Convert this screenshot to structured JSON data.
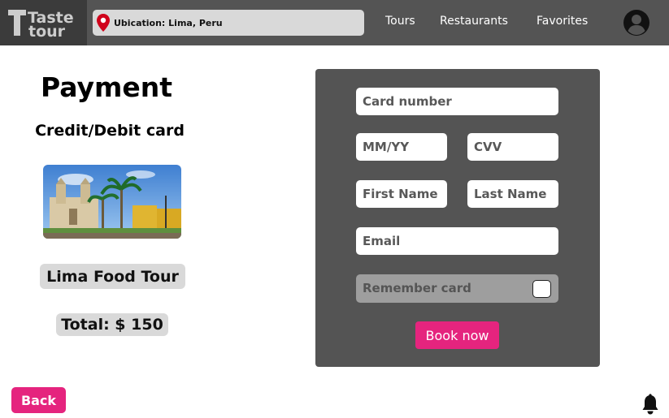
{
  "header": {
    "logo": {
      "line1": "Taste",
      "line2": "tour"
    },
    "search": {
      "text": "Ubication: Lima, Peru",
      "icon": "location-pin-icon"
    },
    "nav": [
      {
        "label": "Tours"
      },
      {
        "label": "Restaurants"
      },
      {
        "label": "Favorites"
      }
    ],
    "profile_icon": "user-avatar-icon"
  },
  "summary": {
    "title": "Payment",
    "subtitle": "Credit/Debit card",
    "tour_name": "Lima Food Tour",
    "total": "Total: $ 150"
  },
  "form": {
    "card_number_placeholder": "Card number",
    "expiry_placeholder": "MM/YY",
    "cvv_placeholder": "CVV",
    "first_name_placeholder": "First Name",
    "last_name_placeholder": "Last Name",
    "email_placeholder": "Email",
    "remember_label": "Remember card",
    "book_label": "Book now"
  },
  "footer": {
    "back_label": "Back",
    "bell_icon": "notification-bell-icon"
  },
  "colors": {
    "accent": "#e5247e",
    "topbar": "#545454",
    "panel": "#545454",
    "badge": "#d9d9d9"
  }
}
